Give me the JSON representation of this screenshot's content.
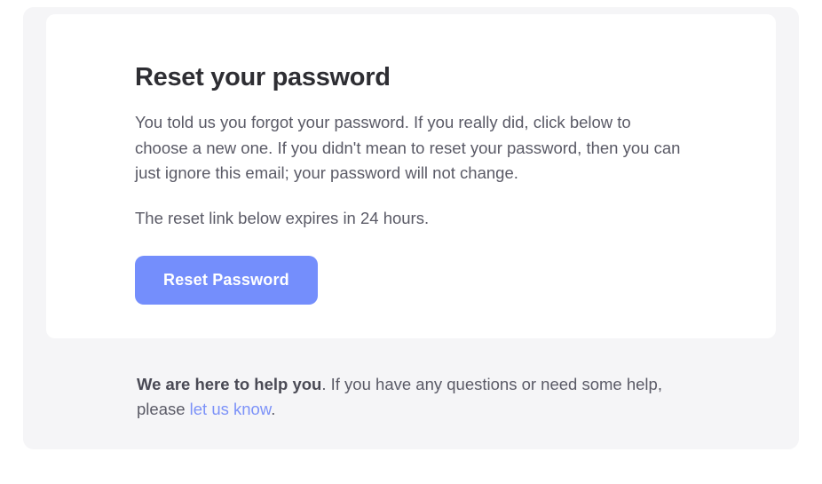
{
  "card": {
    "heading": "Reset your password",
    "body": "You told us you forgot your password. If you really did, click below to choose a new one. If you didn't mean to reset your password, then you can just ignore this email; your password will not change.",
    "expire": "The reset link below expires in 24 hours.",
    "button_label": "Reset Password"
  },
  "footer": {
    "strong": "We are here to help you",
    "text_before": ". If you have any questions or need some help, please ",
    "link_text": "let us know",
    "text_after": "."
  }
}
